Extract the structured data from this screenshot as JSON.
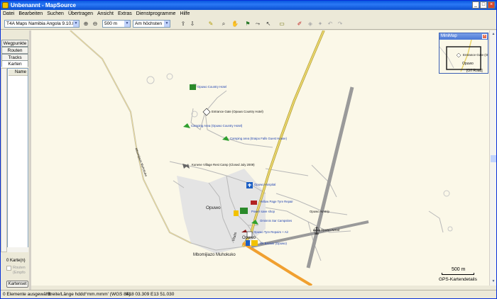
{
  "window": {
    "title": "Unbenannt - MapSource",
    "buttons": [
      "_",
      "□",
      "×"
    ]
  },
  "menu": [
    "Datei",
    "Bearbeiten",
    "Suchen",
    "Übertragen",
    "Ansicht",
    "Extras",
    "Dienstprogramme",
    "Hilfe"
  ],
  "toolbar": {
    "map_product": "T4A Maps Namibia Angola 9.10.8",
    "zoom_scale": "500 m",
    "detail_level": "Am höchsten"
  },
  "sidebar": {
    "tabs": [
      "Wegpunkte",
      "Routen",
      "Tracks",
      "Karten"
    ],
    "active_tab": "Karten",
    "column_header": "Name",
    "count": "0 Karte(n)",
    "checkbox_label_1": "Routen",
    "checkbox_label_2": "(Empfo",
    "button": "Kartenset"
  },
  "map": {
    "labels": {
      "hotel": "Opuwo Country Hotel",
      "entrance": "Entrance Gate (Opuwo Country Hotel)",
      "camp1": "Camping Area (Opuwo Country Hotel)",
      "camp2": "Camping area (Eraipo Falls Guest House)",
      "restcamp": "Kunene Village Rest Camp (Closed July 2009)",
      "road_west": "Mbomijiazo Muhokuko",
      "hospital": "Opuwo Hospital",
      "tyre1": "Yellow Page Tyre Repair",
      "power": "Power save shop",
      "camp3": "Ominnis Sar Campsites",
      "town": "Opuwo",
      "airstrip": "Opuwo Airstrip",
      "aero": "Opuwo Aerod",
      "tyre2": "Opuwo Tyre Repairs + Air",
      "town2": "Opuwo",
      "bazaar": "Ok Bazaar (Opuwo)",
      "road_south": "Mbomijiazo Muhokuko",
      "road_vitalis": "Vitalis"
    },
    "scale_label": "500 m",
    "details_label": "GPS-Kartendetails"
  },
  "minimap": {
    "title": "MiniMap",
    "close": "×",
    "label_gate": "Entrance Gate (O",
    "label_town": "Opuwo",
    "label_road": "[Off Road]"
  },
  "status": {
    "selection": "0 Elemente ausgewählt",
    "format": "Breite/Länge hddd°mm.mmm' (WGS 84)",
    "coords": "S18 03.309 E13 51.030"
  },
  "colors": {
    "titlebar": "#0a58e0",
    "map_bg": "#fbf8e8",
    "main_road": "#e8d46a",
    "orange_road": "#f0a030",
    "runway": "#9a9a9a",
    "poi_text": "#1b3fb0"
  }
}
